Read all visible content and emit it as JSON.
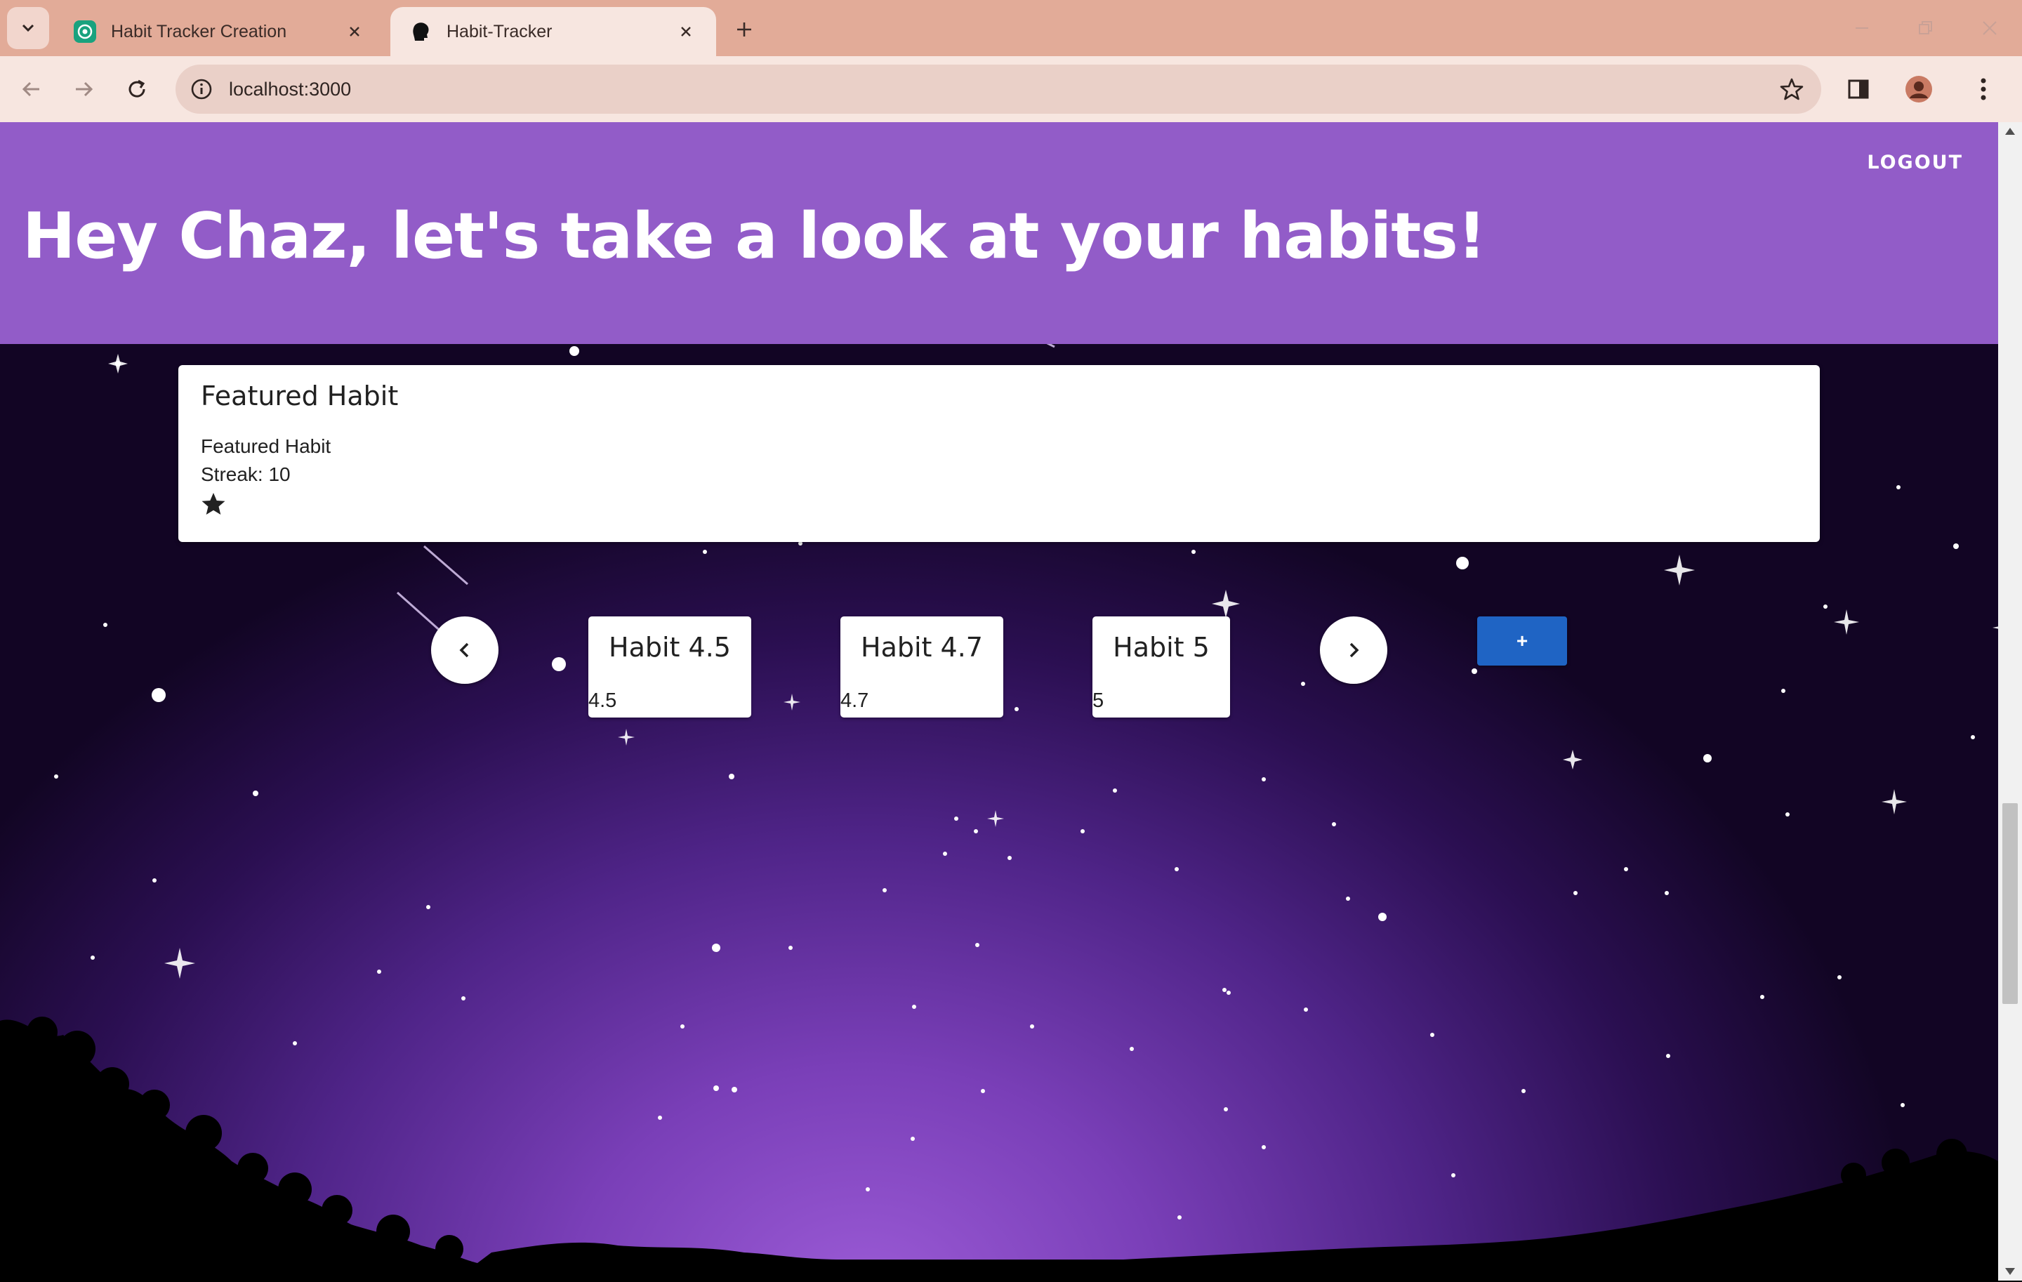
{
  "browser": {
    "tabs": [
      {
        "title": "Habit Tracker Creation",
        "favicon": "chatgpt-icon",
        "active": false
      },
      {
        "title": "Habit-Tracker",
        "favicon": "app-head-icon",
        "active": true
      }
    ],
    "url": "localhost:3000"
  },
  "header": {
    "greeting": "Hey Chaz, let's take a look at your habits!",
    "logout_label": "LOGOUT",
    "background": "#925cc8"
  },
  "featured": {
    "heading": "Featured Habit",
    "habit_name": "Featured Habit",
    "streak_text": "Streak: 10",
    "icon": "star-icon"
  },
  "carousel": {
    "prev_icon": "chevron-left-icon",
    "next_icon": "chevron-right-icon",
    "habits": [
      {
        "name": "Habit 4.5",
        "value": "4.5"
      },
      {
        "name": "Habit 4.7",
        "value": "4.7"
      },
      {
        "name": "Habit 5",
        "value": "5"
      }
    ],
    "add_label": "+",
    "add_color": "#1f64c4"
  }
}
